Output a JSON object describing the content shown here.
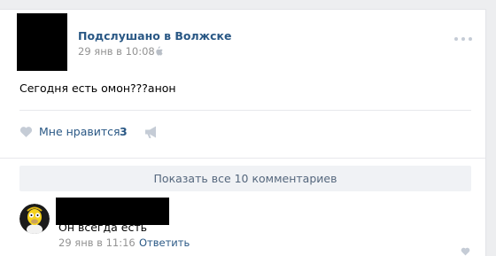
{
  "post": {
    "group_name": "Подслушано в Волжске",
    "date": "29 янв в 10:08",
    "text": "Сегодня есть омон???анон",
    "likes_label": "Мне нравится",
    "likes_count": "3"
  },
  "comments": {
    "show_all_label": "Показать все 10 комментариев",
    "items": [
      {
        "text": "Он всегда есть",
        "date": "29 янв в 11:16",
        "reply_label": "Ответить"
      }
    ]
  },
  "colors": {
    "link": "#2a5885",
    "muted": "#939393",
    "background": "#edeef0",
    "icon_grey": "#c5ccd6"
  },
  "icons": {
    "platform": "apple-icon",
    "menu": "more-dots-icon",
    "like": "heart-icon",
    "share": "megaphone-icon"
  }
}
